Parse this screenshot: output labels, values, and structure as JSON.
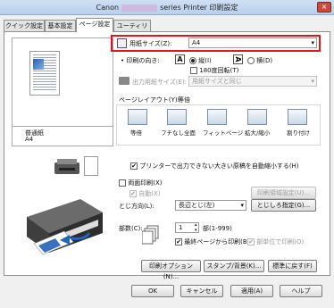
{
  "window": {
    "title_left": "Canon",
    "title_right": "series Printer 印刷設定",
    "close": "×"
  },
  "tabs": [
    {
      "label": "クイック設定"
    },
    {
      "label": "基本設定"
    },
    {
      "label": "ページ設定"
    },
    {
      "label": "ユーティリティ"
    }
  ],
  "preview": {
    "media_line1": "普通紙",
    "media_line2": "A4"
  },
  "page_size": {
    "label": "用紙サイズ(Z):",
    "value": "A4"
  },
  "orientation": {
    "label": "印刷の向き:",
    "portrait": "縦(I)",
    "landscape": "横(D)",
    "rotate": "180度回転(T)"
  },
  "output_size": {
    "label": "出力用紙サイズ(E):",
    "value": "用紙サイズと同じ"
  },
  "page_layout": {
    "label": "ページレイアウト(Y):",
    "value": "等倍",
    "options": [
      "等倍",
      "フチなし全面",
      "フィットページ",
      "拡大/縮小",
      "割り付け"
    ]
  },
  "reduce_check": "プリンターで出力できない大きい原稿を自動縮小する(H)",
  "duplex": {
    "label": "両面印刷(X)",
    "auto": "自動(X)",
    "settings_btn": "印刷領域設定(U)..."
  },
  "binding": {
    "label": "とじ方向(L):",
    "value": "長辺とじ(左)",
    "margin_btn": "とじしろ指定(G)..."
  },
  "copies": {
    "label": "部数(C):",
    "value": "1",
    "range": "部(1-999)",
    "reverse": "最終ページから印刷(B)",
    "collate": "部単位で印刷(O)"
  },
  "option_buttons": {
    "print_options": "印刷オプション(N)...",
    "stamp": "スタンプ/背景(K)...",
    "defaults": "標準に戻す(F)"
  },
  "footer": {
    "ok": "OK",
    "cancel": "キャンセル",
    "apply": "適用(A)",
    "help": "ヘルプ"
  }
}
